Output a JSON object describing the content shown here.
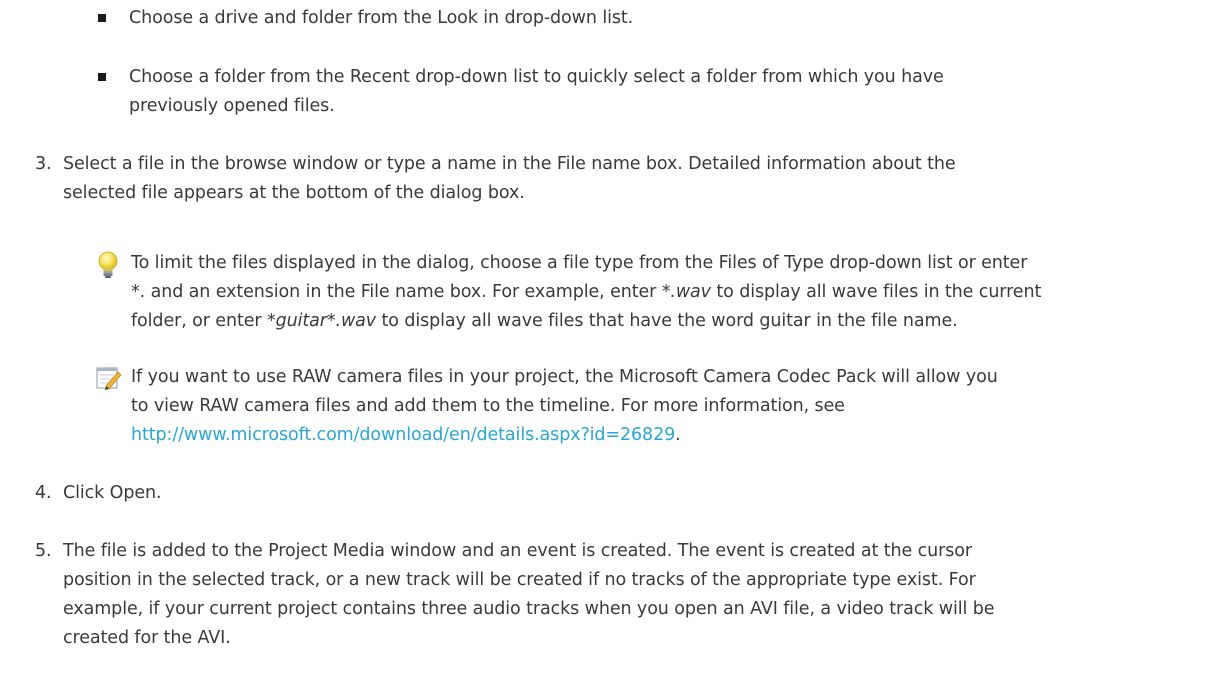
{
  "bullets": [
    {
      "lines": [
        "Choose a drive and folder from the Look in drop-down list."
      ]
    },
    {
      "lines": [
        "Choose a folder from the Recent drop-down list to quickly select a folder from which you have",
        "previously opened files."
      ]
    }
  ],
  "step3": {
    "number": "3.",
    "lines": [
      "Select a file in the browse window or type a name in the File name box. Detailed information about the",
      "selected file appears at the bottom of the dialog box."
    ]
  },
  "tip": {
    "icon": "lightbulb-icon",
    "line1": "To limit the files displayed in the dialog, choose a file type from the Files of Type drop-down list or enter",
    "line2_pre": "*. and an extension in the File name box. For example, enter ",
    "line2_em": "*.wav",
    "line2_post": " to display all wave files in the current",
    "line3_pre": "folder, or enter ",
    "line3_em": "*guitar*.wav",
    "line3_post": " to display all wave files that have the word guitar in the file name."
  },
  "note": {
    "icon": "notepad-pencil-icon",
    "line1": "If you want to use RAW camera files in your project, the Microsoft Camera Codec Pack will allow you",
    "line2": "to view RAW camera files and add them to the timeline. For more information, see",
    "link": "http://www.microsoft.com/download/en/details.aspx?id=26829",
    "link_suffix": ".",
    "link_color": "#2aa6d6"
  },
  "step4": {
    "number": "4.",
    "text": "Click Open."
  },
  "step5": {
    "number": "5.",
    "lines": [
      "The file is added to the Project Media window and an event is created. The event is created at the cursor",
      "position in the selected track, or a new track will be created if no tracks of the appropriate type exist. For",
      "example, if your current project contains three audio tracks when you open an AVI file, a video track will be",
      "created for the AVI."
    ]
  }
}
